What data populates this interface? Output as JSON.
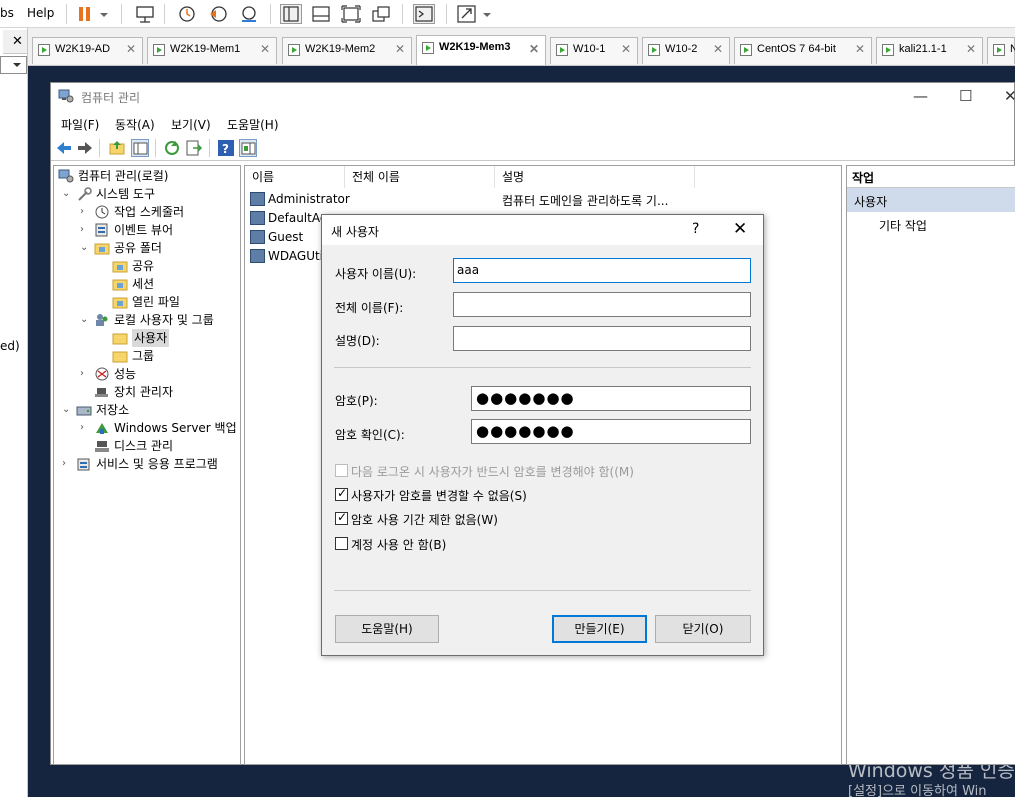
{
  "vm_menu": {
    "partial_left": "bs",
    "help": "Help"
  },
  "vm_tabs": [
    {
      "label": "W2K19-AD",
      "active": false
    },
    {
      "label": "W2K19-Mem1",
      "active": false
    },
    {
      "label": "W2K19-Mem2",
      "active": false
    },
    {
      "label": "W2K19-Mem3",
      "active": true
    },
    {
      "label": "W10-1",
      "active": false
    },
    {
      "label": "W10-2",
      "active": false
    },
    {
      "label": "CentOS 7 64-bit",
      "active": false
    },
    {
      "label": "kali21.1-1",
      "active": false
    },
    {
      "label": "N",
      "active": false
    }
  ],
  "left_strip": {
    "partial_text": "ed)"
  },
  "window": {
    "title": "컴퓨터 관리",
    "menu": [
      "파일(F)",
      "동작(A)",
      "보기(V)",
      "도움말(H)"
    ]
  },
  "tree": [
    {
      "label": "컴퓨터 관리(로컬)",
      "level": 0,
      "exp": ""
    },
    {
      "label": "시스템 도구",
      "level": 1,
      "exp": "⌄"
    },
    {
      "label": "작업 스케줄러",
      "level": 2,
      "exp": "›"
    },
    {
      "label": "이벤트 뷰어",
      "level": 2,
      "exp": "›"
    },
    {
      "label": "공유 폴더",
      "level": 2,
      "exp": "⌄"
    },
    {
      "label": "공유",
      "level": 3,
      "exp": ""
    },
    {
      "label": "세션",
      "level": 3,
      "exp": ""
    },
    {
      "label": "열린 파일",
      "level": 3,
      "exp": ""
    },
    {
      "label": "로컬 사용자 및 그룹",
      "level": 2,
      "exp": "⌄"
    },
    {
      "label": "사용자",
      "level": 3,
      "exp": "",
      "selected": true
    },
    {
      "label": "그룹",
      "level": 3,
      "exp": ""
    },
    {
      "label": "성능",
      "level": 2,
      "exp": "›"
    },
    {
      "label": "장치 관리자",
      "level": 2,
      "exp": ""
    },
    {
      "label": "저장소",
      "level": 1,
      "exp": "⌄"
    },
    {
      "label": "Windows Server 백업",
      "level": 2,
      "exp": "›"
    },
    {
      "label": "디스크 관리",
      "level": 2,
      "exp": ""
    },
    {
      "label": "서비스 및 응용 프로그램",
      "level": 1,
      "exp": "›"
    }
  ],
  "list": {
    "headers": [
      "이름",
      "전체 이름",
      "설명"
    ],
    "rows": [
      {
        "name": "Administrator",
        "desc": "컴퓨터 도메인을 관리하도록 기..."
      },
      {
        "name": "DefaultAc",
        "desc": ""
      },
      {
        "name": "Guest",
        "desc": ""
      },
      {
        "name": "WDAGUtil",
        "desc": ""
      }
    ]
  },
  "actions": {
    "header": "작업",
    "selected": "사용자",
    "more": "기타 작업"
  },
  "dialog": {
    "title": "새 사용자",
    "help_glyph": "?",
    "close_glyph": "✕",
    "username_label": "사용자 이름(U):",
    "username_value": "aaa",
    "fullname_label": "전체 이름(F):",
    "fullname_value": "",
    "desc_label": "설명(D):",
    "desc_value": "",
    "password_label": "암호(P):",
    "password_mask": "●●●●●●●",
    "confirm_label": "암호 확인(C):",
    "confirm_mask": "●●●●●●●",
    "checkboxes": [
      {
        "label": "다음 로그온 시 사용자가 반드시 암호를 변경해야 함((M)",
        "checked": false,
        "disabled": true
      },
      {
        "label": "사용자가 암호를 변경할 수 없음(S)",
        "checked": true,
        "disabled": false
      },
      {
        "label": "암호 사용 기간 제한 없음(W)",
        "checked": true,
        "disabled": false
      },
      {
        "label": "계정 사용 안 함(B)",
        "checked": false,
        "disabled": false
      }
    ],
    "help_button": "도움말(H)",
    "create_button": "만들기(E)",
    "close_button": "닫기(O)"
  },
  "watermark": {
    "line1": "Windows 정품 인증",
    "line2": "[설정]으로 이동하여 Win"
  },
  "colors": {
    "accent": "#0078d7",
    "guest_bg": "#15243f",
    "pause": "#e8731e",
    "selected_action": "#cfdbeb"
  }
}
